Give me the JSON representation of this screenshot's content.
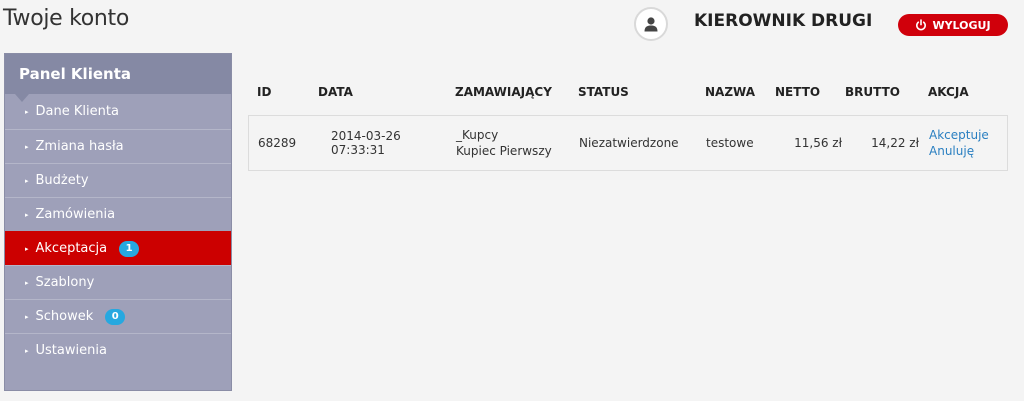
{
  "page": {
    "title": "Twoje konto"
  },
  "header": {
    "user_name": "KIEROWNIK DRUGI",
    "logout_label": "WYLOGUJ",
    "avatar_icon": "user-icon",
    "logout_icon": "power-icon",
    "logout_color": "#d0000b"
  },
  "sidebar": {
    "title": "Panel Klienta",
    "items": [
      {
        "label": "Dane Klienta",
        "active": false
      },
      {
        "label": "Zmiana hasła",
        "active": false
      },
      {
        "label": "Budżety",
        "active": false
      },
      {
        "label": "Zamówienia",
        "active": false
      },
      {
        "label": "Akceptacja",
        "active": true,
        "badge": "1"
      },
      {
        "label": "Szablony",
        "active": false
      },
      {
        "label": "Schowek",
        "active": false,
        "badge": "0"
      },
      {
        "label": "Ustawienia",
        "active": false
      }
    ],
    "active_color": "#cc0000",
    "badge_color": "#26a8e0"
  },
  "orders": {
    "columns": [
      "ID",
      "DATA",
      "ZAMAWIAJĄCY",
      "STATUS",
      "NAZWA",
      "NETTO",
      "BRUTTO",
      "AKCJA"
    ],
    "rows": [
      {
        "id": "68289",
        "data": "2014-03-26 07:33:31",
        "zamawiajacy_line1": "_Kupcy",
        "zamawiajacy_line2": "Kupiec Pierwszy",
        "status": "Niezatwierdzone",
        "nazwa": "testowe",
        "netto": "11,56 zł",
        "brutto": "14,22 zł",
        "actions": [
          "Akceptuje",
          "Anuluję"
        ]
      }
    ]
  }
}
